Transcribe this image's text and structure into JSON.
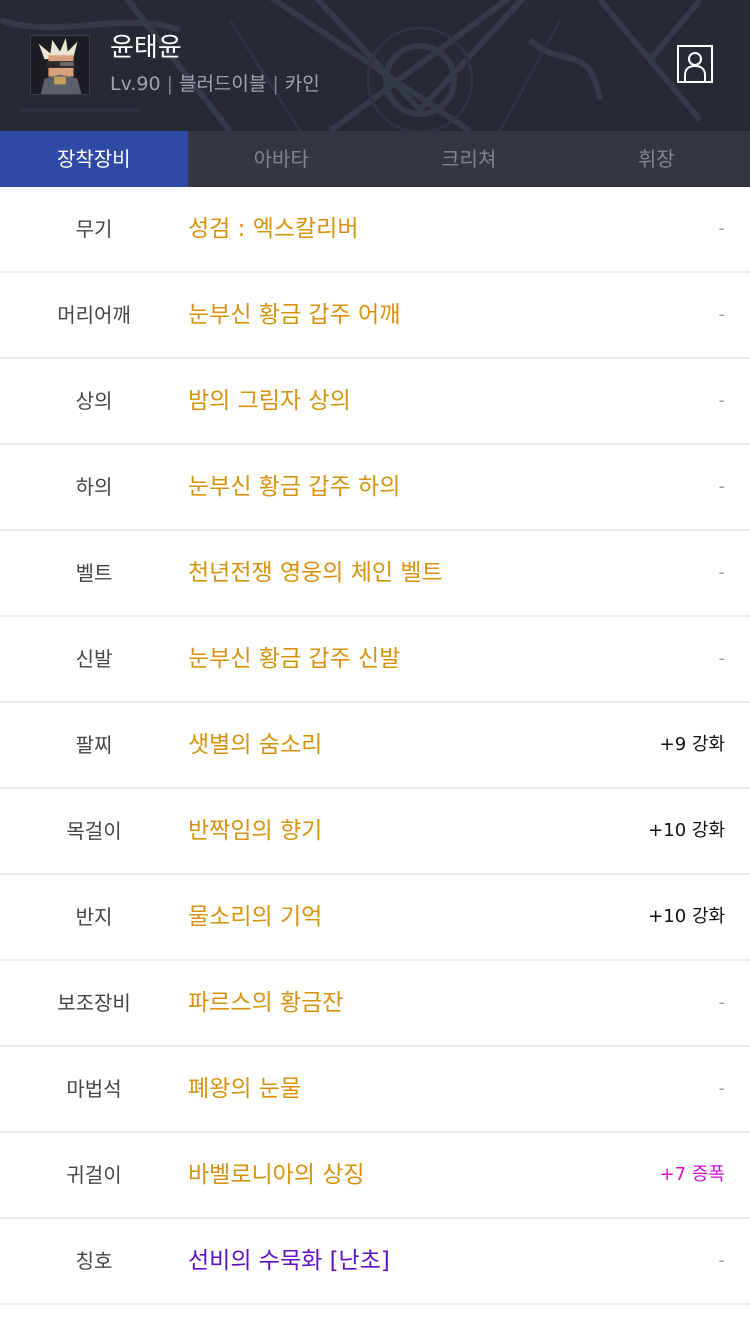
{
  "colors": {
    "header_bg": "#262a35",
    "tab_bar_bg": "#333741",
    "tab_active_bg": "#2e4aa4",
    "item_gold": "#d9920f",
    "item_purple": "#5e10c6",
    "amplify_magenta": "#cc10cc"
  },
  "character": {
    "name": "윤태윤",
    "level": "Lv.90",
    "job": "블러드이블",
    "server": "카인",
    "separator": "|",
    "avatar_icon": "character-portrait-icon",
    "profile_icon": "person-profile-icon"
  },
  "tabs": [
    {
      "label": "장착장비",
      "active": true
    },
    {
      "label": "아바타",
      "active": false
    },
    {
      "label": "크리쳐",
      "active": false
    },
    {
      "label": "휘장",
      "active": false
    }
  ],
  "equipment": [
    {
      "slot": "무기",
      "item": "성검 : 엑스칼리버",
      "extra": "-",
      "item_color": "#d9920f",
      "extra_color": "#9a9a9a"
    },
    {
      "slot": "머리어깨",
      "item": "눈부신 황금 갑주 어깨",
      "extra": "-",
      "item_color": "#d9920f",
      "extra_color": "#9a9a9a"
    },
    {
      "slot": "상의",
      "item": "밤의 그림자 상의",
      "extra": "-",
      "item_color": "#d9920f",
      "extra_color": "#9a9a9a"
    },
    {
      "slot": "하의",
      "item": "눈부신 황금 갑주 하의",
      "extra": "-",
      "item_color": "#d9920f",
      "extra_color": "#9a9a9a"
    },
    {
      "slot": "벨트",
      "item": "천년전쟁 영웅의 체인 벨트",
      "extra": "-",
      "item_color": "#d9920f",
      "extra_color": "#9a9a9a"
    },
    {
      "slot": "신발",
      "item": "눈부신 황금 갑주 신발",
      "extra": "-",
      "item_color": "#d9920f",
      "extra_color": "#9a9a9a"
    },
    {
      "slot": "팔찌",
      "item": "샛별의 숨소리",
      "extra": "+9 강화",
      "item_color": "#d9920f",
      "extra_color": "#111111"
    },
    {
      "slot": "목걸이",
      "item": "반짝임의 향기",
      "extra": "+10 강화",
      "item_color": "#d9920f",
      "extra_color": "#111111"
    },
    {
      "slot": "반지",
      "item": "물소리의 기억",
      "extra": "+10 강화",
      "item_color": "#d9920f",
      "extra_color": "#111111"
    },
    {
      "slot": "보조장비",
      "item": "파르스의 황금잔",
      "extra": "-",
      "item_color": "#d9920f",
      "extra_color": "#9a9a9a"
    },
    {
      "slot": "마법석",
      "item": "폐왕의 눈물",
      "extra": "-",
      "item_color": "#d9920f",
      "extra_color": "#9a9a9a"
    },
    {
      "slot": "귀걸이",
      "item": "바벨로니아의 상징",
      "extra": "+7 증폭",
      "item_color": "#d9920f",
      "extra_color": "#cc10cc"
    },
    {
      "slot": "칭호",
      "item": "선비의 수묵화 [난초]",
      "extra": "-",
      "item_color": "#5e10c6",
      "extra_color": "#9a9a9a"
    }
  ]
}
